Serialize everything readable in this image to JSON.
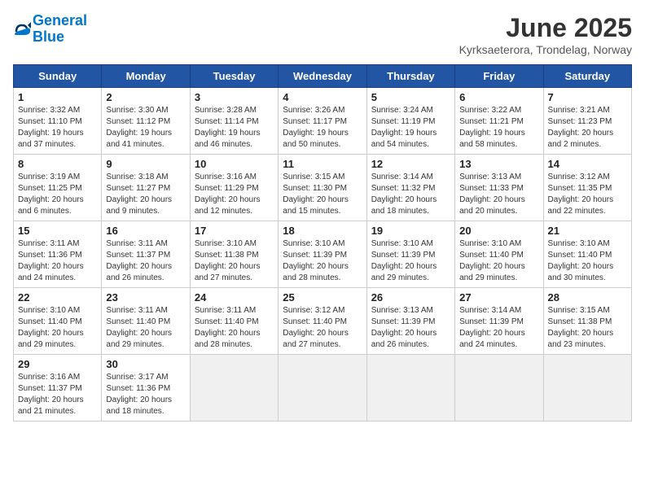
{
  "header": {
    "logo_line1": "General",
    "logo_line2": "Blue",
    "title": "June 2025",
    "subtitle": "Kyrksaeterora, Trondelag, Norway"
  },
  "weekdays": [
    "Sunday",
    "Monday",
    "Tuesday",
    "Wednesday",
    "Thursday",
    "Friday",
    "Saturday"
  ],
  "weeks": [
    [
      {
        "day": "1",
        "info": "Sunrise: 3:32 AM\nSunset: 11:10 PM\nDaylight: 19 hours\nand 37 minutes."
      },
      {
        "day": "2",
        "info": "Sunrise: 3:30 AM\nSunset: 11:12 PM\nDaylight: 19 hours\nand 41 minutes."
      },
      {
        "day": "3",
        "info": "Sunrise: 3:28 AM\nSunset: 11:14 PM\nDaylight: 19 hours\nand 46 minutes."
      },
      {
        "day": "4",
        "info": "Sunrise: 3:26 AM\nSunset: 11:17 PM\nDaylight: 19 hours\nand 50 minutes."
      },
      {
        "day": "5",
        "info": "Sunrise: 3:24 AM\nSunset: 11:19 PM\nDaylight: 19 hours\nand 54 minutes."
      },
      {
        "day": "6",
        "info": "Sunrise: 3:22 AM\nSunset: 11:21 PM\nDaylight: 19 hours\nand 58 minutes."
      },
      {
        "day": "7",
        "info": "Sunrise: 3:21 AM\nSunset: 11:23 PM\nDaylight: 20 hours\nand 2 minutes."
      }
    ],
    [
      {
        "day": "8",
        "info": "Sunrise: 3:19 AM\nSunset: 11:25 PM\nDaylight: 20 hours\nand 6 minutes."
      },
      {
        "day": "9",
        "info": "Sunrise: 3:18 AM\nSunset: 11:27 PM\nDaylight: 20 hours\nand 9 minutes."
      },
      {
        "day": "10",
        "info": "Sunrise: 3:16 AM\nSunset: 11:29 PM\nDaylight: 20 hours\nand 12 minutes."
      },
      {
        "day": "11",
        "info": "Sunrise: 3:15 AM\nSunset: 11:30 PM\nDaylight: 20 hours\nand 15 minutes."
      },
      {
        "day": "12",
        "info": "Sunrise: 3:14 AM\nSunset: 11:32 PM\nDaylight: 20 hours\nand 18 minutes."
      },
      {
        "day": "13",
        "info": "Sunrise: 3:13 AM\nSunset: 11:33 PM\nDaylight: 20 hours\nand 20 minutes."
      },
      {
        "day": "14",
        "info": "Sunrise: 3:12 AM\nSunset: 11:35 PM\nDaylight: 20 hours\nand 22 minutes."
      }
    ],
    [
      {
        "day": "15",
        "info": "Sunrise: 3:11 AM\nSunset: 11:36 PM\nDaylight: 20 hours\nand 24 minutes."
      },
      {
        "day": "16",
        "info": "Sunrise: 3:11 AM\nSunset: 11:37 PM\nDaylight: 20 hours\nand 26 minutes."
      },
      {
        "day": "17",
        "info": "Sunrise: 3:10 AM\nSunset: 11:38 PM\nDaylight: 20 hours\nand 27 minutes."
      },
      {
        "day": "18",
        "info": "Sunrise: 3:10 AM\nSunset: 11:39 PM\nDaylight: 20 hours\nand 28 minutes."
      },
      {
        "day": "19",
        "info": "Sunrise: 3:10 AM\nSunset: 11:39 PM\nDaylight: 20 hours\nand 29 minutes."
      },
      {
        "day": "20",
        "info": "Sunrise: 3:10 AM\nSunset: 11:40 PM\nDaylight: 20 hours\nand 29 minutes."
      },
      {
        "day": "21",
        "info": "Sunrise: 3:10 AM\nSunset: 11:40 PM\nDaylight: 20 hours\nand 30 minutes."
      }
    ],
    [
      {
        "day": "22",
        "info": "Sunrise: 3:10 AM\nSunset: 11:40 PM\nDaylight: 20 hours\nand 29 minutes."
      },
      {
        "day": "23",
        "info": "Sunrise: 3:11 AM\nSunset: 11:40 PM\nDaylight: 20 hours\nand 29 minutes."
      },
      {
        "day": "24",
        "info": "Sunrise: 3:11 AM\nSunset: 11:40 PM\nDaylight: 20 hours\nand 28 minutes."
      },
      {
        "day": "25",
        "info": "Sunrise: 3:12 AM\nSunset: 11:40 PM\nDaylight: 20 hours\nand 27 minutes."
      },
      {
        "day": "26",
        "info": "Sunrise: 3:13 AM\nSunset: 11:39 PM\nDaylight: 20 hours\nand 26 minutes."
      },
      {
        "day": "27",
        "info": "Sunrise: 3:14 AM\nSunset: 11:39 PM\nDaylight: 20 hours\nand 24 minutes."
      },
      {
        "day": "28",
        "info": "Sunrise: 3:15 AM\nSunset: 11:38 PM\nDaylight: 20 hours\nand 23 minutes."
      }
    ],
    [
      {
        "day": "29",
        "info": "Sunrise: 3:16 AM\nSunset: 11:37 PM\nDaylight: 20 hours\nand 21 minutes."
      },
      {
        "day": "30",
        "info": "Sunrise: 3:17 AM\nSunset: 11:36 PM\nDaylight: 20 hours\nand 18 minutes."
      },
      {
        "day": "",
        "info": ""
      },
      {
        "day": "",
        "info": ""
      },
      {
        "day": "",
        "info": ""
      },
      {
        "day": "",
        "info": ""
      },
      {
        "day": "",
        "info": ""
      }
    ]
  ]
}
